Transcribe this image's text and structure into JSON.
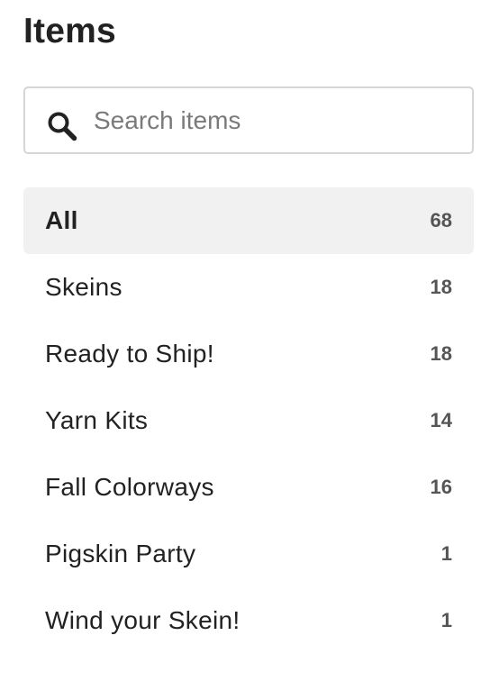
{
  "header": {
    "title": "Items"
  },
  "search": {
    "placeholder": "Search items",
    "value": "",
    "icon": "search-icon"
  },
  "sections": [
    {
      "label": "All",
      "count": "68",
      "selected": true
    },
    {
      "label": "Skeins",
      "count": "18",
      "selected": false
    },
    {
      "label": "Ready to Ship!",
      "count": "18",
      "selected": false
    },
    {
      "label": "Yarn Kits",
      "count": "14",
      "selected": false
    },
    {
      "label": "Fall Colorways",
      "count": "16",
      "selected": false
    },
    {
      "label": "Pigskin Party",
      "count": "1",
      "selected": false
    },
    {
      "label": "Wind your Skein!",
      "count": "1",
      "selected": false
    }
  ],
  "colors": {
    "selected_background": "#f1f1f1",
    "text": "#222222",
    "count_text": "#555555",
    "placeholder": "#7a7a7a",
    "search_border": "#d6d6d6"
  }
}
